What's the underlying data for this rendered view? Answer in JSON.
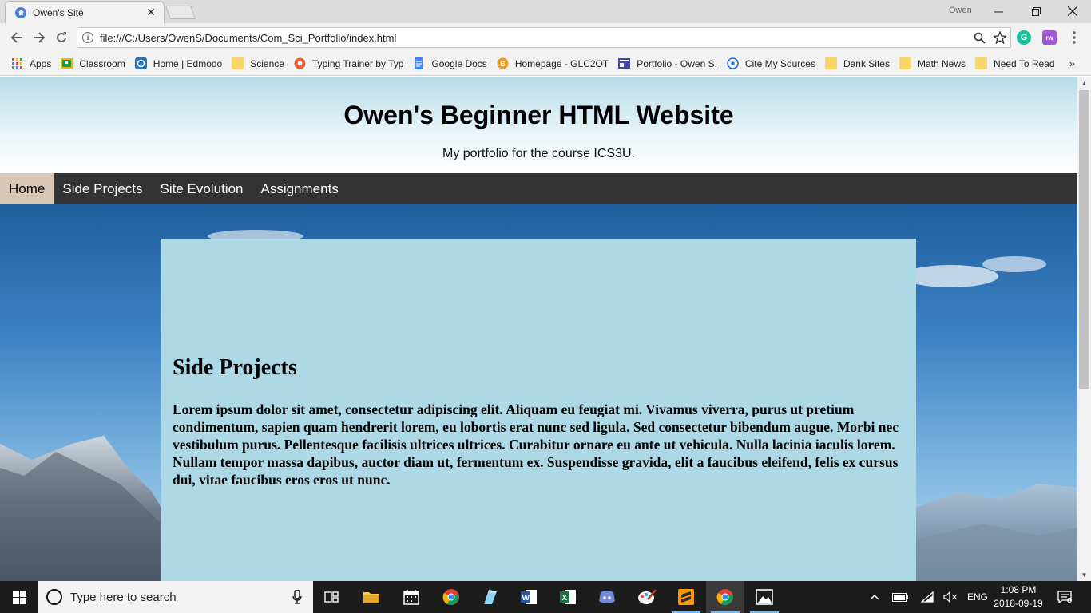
{
  "browser": {
    "tab_title": "Owen's Site",
    "tab_close": "✕",
    "profile_name": "Owen",
    "url": "file:///C:/Users/OwenS/Documents/Com_Sci_Portfolio/index.html",
    "info_glyph": "i"
  },
  "bookmarks": [
    {
      "label": "Apps"
    },
    {
      "label": "Classroom"
    },
    {
      "label": "Home | Edmodo"
    },
    {
      "label": "Science"
    },
    {
      "label": "Typing Trainer by Typ"
    },
    {
      "label": "Google Docs"
    },
    {
      "label": "Homepage - GLC2OT"
    },
    {
      "label": "Portfolio - Owen S."
    },
    {
      "label": "Cite My Sources"
    },
    {
      "label": "Dank Sites"
    },
    {
      "label": "Math News"
    },
    {
      "label": "Need To Read"
    }
  ],
  "bookmarks_more": "»",
  "site": {
    "title": "Owen's Beginner HTML Website",
    "subtitle": "My portfolio for the course ICS3U.",
    "nav": [
      "Home",
      "Side Projects",
      "Site Evolution",
      "Assignments"
    ],
    "active_nav": "Home",
    "section_heading": "Side Projects",
    "section_body": "Lorem ipsum dolor sit amet, consectetur adipiscing elit. Aliquam eu feugiat mi. Vivamus viverra, purus ut pretium condimentum, sapien quam hendrerit lorem, eu lobortis erat nunc sed ligula. Sed consectetur bibendum augue. Morbi nec vestibulum purus. Pellentesque facilisis ultrices ultrices. Curabitur ornare eu ante ut vehicula. Nulla lacinia iaculis lorem. Nullam tempor massa dapibus, auctor diam ut, fermentum ex. Suspendisse gravida, elit a faucibus eleifend, felis ex cursus dui, vitae faucibus eros eros ut nunc."
  },
  "taskbar": {
    "search_placeholder": "Type here to search",
    "language": "ENG",
    "time": "1:08 PM",
    "date": "2018-09-19"
  },
  "colors": {
    "nav_bg": "#333333",
    "nav_active": "#d9c8b7",
    "content_bg": "#add8e6"
  }
}
